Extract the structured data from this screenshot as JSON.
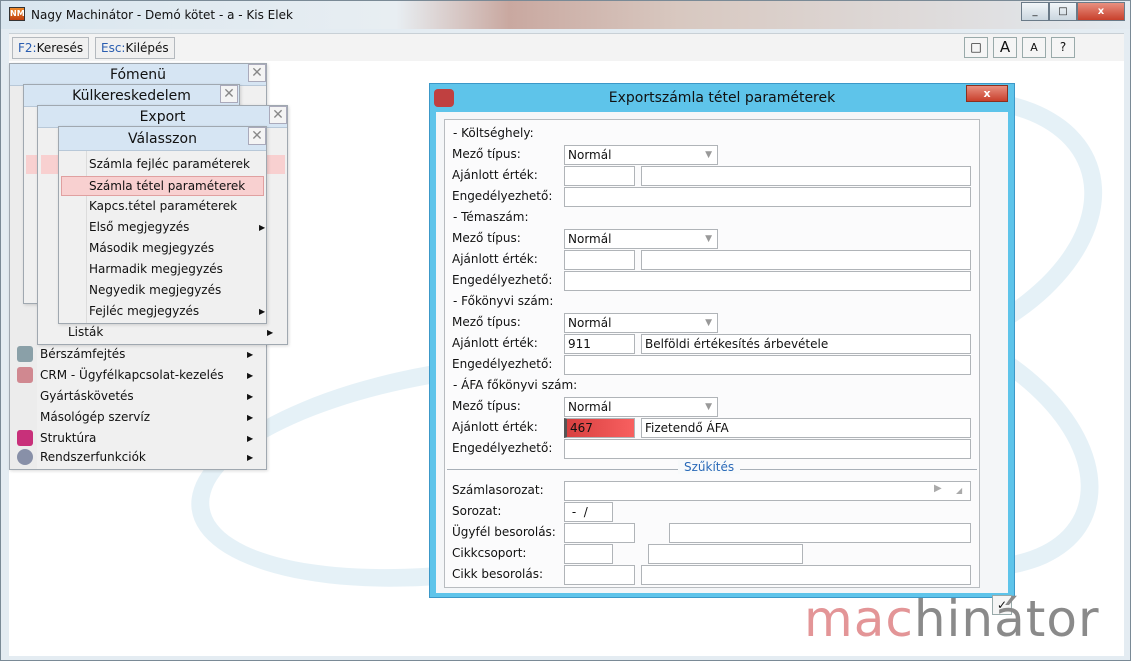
{
  "window": {
    "title": "Nagy Machinátor - Demó kötet - a - Kis Elek",
    "controls": [
      "_",
      "□",
      "x"
    ]
  },
  "toolbar": {
    "search_key": "F2:",
    "search_label": "Keresés",
    "exit_key": "Esc:",
    "exit_label": "Kilépés",
    "right_buttons": [
      "□",
      "A",
      "A",
      "?"
    ]
  },
  "menus": {
    "main": {
      "title": "Fómenü",
      "items": [
        {
          "label": "Bérszámfejtés",
          "icon": "payroll-icon"
        },
        {
          "label": "CRM - Ügyfélkapcsolat-kezelés",
          "icon": "crm-icon"
        },
        {
          "label": "Gyártáskövetés",
          "icon": ""
        },
        {
          "label": "Másológép szervíz",
          "icon": ""
        },
        {
          "label": "Struktúra",
          "icon": "structure-icon"
        },
        {
          "label": "Rendszerfunkciók",
          "icon": "gears-icon"
        }
      ]
    },
    "foreign_trade": {
      "title": "Külkereskedelem"
    },
    "export": {
      "title": "Export",
      "items": [
        {
          "label": "Listák"
        }
      ]
    },
    "choose": {
      "title": "Válasszon",
      "items": [
        {
          "label": "Számla fejléc paraméterek",
          "sub": false
        },
        {
          "label": "Számla tétel paraméterek",
          "sub": false,
          "selected": true
        },
        {
          "label": "Kapcs.tétel paraméterek",
          "sub": false
        },
        {
          "label": "Első megjegyzés",
          "sub": true
        },
        {
          "label": "Második megjegyzés",
          "sub": false
        },
        {
          "label": "Harmadik megjegyzés",
          "sub": false
        },
        {
          "label": "Negyedik megjegyzés",
          "sub": false
        },
        {
          "label": "Fejléc megjegyzés",
          "sub": true
        }
      ]
    },
    "close_symbol": "✕",
    "submenu_arrow": "▶"
  },
  "dialog": {
    "title": "Exportszámla tétel paraméterek",
    "close": "x",
    "labels": {
      "field_type": "Mező típus:",
      "suggested": "Ajánlott érték:",
      "allowed": "Engedélyezhető:"
    },
    "sections": [
      {
        "title": "- Költséghely:",
        "field_type": "Normál",
        "code": "",
        "name": "",
        "allowed": ""
      },
      {
        "title": "- Témaszám:",
        "field_type": "Normál",
        "code": "",
        "name": "",
        "allowed": ""
      },
      {
        "title": "- Főkönyvi szám:",
        "field_type": "Normál",
        "code": "911",
        "name": "Belföldi értékesítés árbevétele",
        "allowed": ""
      },
      {
        "title": "- ÁFA főkönyvi szám:",
        "field_type": "Normál",
        "code": "467",
        "name": "Fizetendő ÁFA",
        "allowed": "",
        "error": true
      }
    ],
    "narrowing": {
      "title": "Szűkítés",
      "invoice_series_label": "Számlasorozat:",
      "invoice_series": "",
      "series_label": "Sorozat:",
      "series": " -  /",
      "customer_class_label": "Ügyfél besorolás:",
      "item_group_label": "Cikkcsoport:",
      "item_class_label": "Cikk besorolás:"
    },
    "ok": "✓"
  },
  "logo": {
    "part1": "mac",
    "part2": "hinátor"
  },
  "colors": {
    "accent": "#5ec4ea",
    "selected": "#f8d0d0",
    "error": "#f04848"
  }
}
